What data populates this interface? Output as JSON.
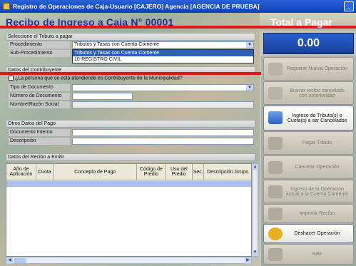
{
  "window": {
    "title": "Registro de Operaciones de Caja-Usuario [CAJERO] Agencia [AGENCIA DE PRUEBA]"
  },
  "page_title": "Recibo de Ingreso a Caja N°   00001",
  "totales": {
    "title": "Total a Pagar",
    "amount": "0.00"
  },
  "tributo": {
    "section": "Seleccione el Tributo a pagar",
    "procedimiento_label": "Procedimiento",
    "procedimiento_value": "Tributos y Tasas con Cuenta Corriente",
    "subprocedimiento_label": "Sub-Procedimiento",
    "options": [
      "Tributos y Tasas con Cuenta Corriente",
      "10-REGISTRO CIVIL"
    ]
  },
  "contribuyente": {
    "section": "Datos del Contribuyente",
    "question": "¿La persona que se está atendiendo es Contribuyente de la Municipalidad?",
    "tipo_label": "Tipo de Documento",
    "numero_label": "Número de Documento",
    "nombre_label": "Nombre/Razón Social"
  },
  "otros": {
    "section": "Otros Datos del Pago",
    "doc_label": "Documento Interno",
    "desc_label": "Descripción"
  },
  "recibo": {
    "section": "Datos del Recibo a Emitir",
    "columns": [
      "Año de Aplicación",
      "Cuota",
      "Concepto de Pago",
      "Código de Predio",
      "Uso del Predio",
      "Sec.",
      "Descripción Grupo"
    ]
  },
  "buttons": {
    "nueva": "Registrar Nueva Operación",
    "buscar": "Buscar recibo cancelado con anterioridad",
    "ingreso": "Ingreso de Tributo(s) o Cuota(s) a ser Cancelados",
    "pagar": "Pagar Tributo",
    "cancelar": "Cancelar Operación",
    "ctacte": "Ingreso de la Operación actual a la Cuenta Corriente",
    "imprimir": "Imprimir Recibo",
    "deshacer": "Deshacer Operación",
    "salir": "Salir"
  },
  "colors": {
    "title_blue": "#2b2aa0",
    "accent_red": "#e01818",
    "total_blue": "#2560cf"
  }
}
